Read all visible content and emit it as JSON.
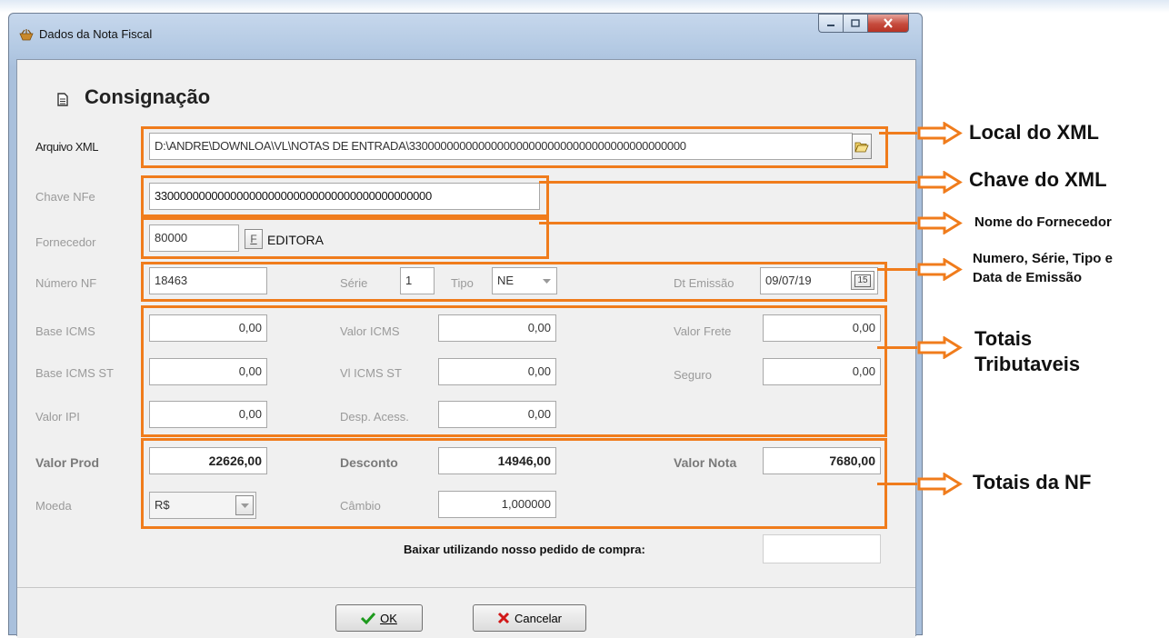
{
  "window": {
    "title": "Dados da Nota Fiscal"
  },
  "form": {
    "heading": "Consignação",
    "xml": {
      "label": "Arquivo XML",
      "value": "D:\\ANDRE\\DOWNLOA\\VL\\NOTAS DE ENTRADA\\33000000000000000000000000000000000000000000"
    },
    "chave": {
      "label": "Chave NFe",
      "value": "33000000000000000000000000000000000000000000"
    },
    "fornecedor": {
      "label": "Fornecedor",
      "code": "80000",
      "button": "F",
      "name": "EDITORA"
    },
    "numero": {
      "label": "Número NF",
      "value": "18463"
    },
    "serie": {
      "label": "Série",
      "value": "1"
    },
    "tipo": {
      "label": "Tipo",
      "value": "NE"
    },
    "emissao": {
      "label": "Dt Emissão",
      "value": "09/07/19",
      "icon": "15"
    },
    "base_icms": {
      "label": "Base ICMS",
      "value": "0,00"
    },
    "valor_icms": {
      "label": "Valor ICMS",
      "value": "0,00"
    },
    "valor_frete": {
      "label": "Valor Frete",
      "value": "0,00"
    },
    "base_icms_st": {
      "label": "Base ICMS ST",
      "value": "0,00"
    },
    "vl_icms_st": {
      "label": "Vl ICMS ST",
      "value": "0,00"
    },
    "seguro": {
      "label": "Seguro",
      "value": "0,00"
    },
    "valor_ipi": {
      "label": "Valor IPI",
      "value": "0,00"
    },
    "desp_acess": {
      "label": "Desp. Acess.",
      "value": "0,00"
    },
    "valor_prod": {
      "label": "Valor Prod",
      "value": "22626,00"
    },
    "desconto": {
      "label": "Desconto",
      "value": "14946,00"
    },
    "valor_nota": {
      "label": "Valor Nota",
      "value": "7680,00"
    },
    "moeda": {
      "label": "Moeda",
      "value": "R$"
    },
    "cambio": {
      "label": "Câmbio",
      "value": "1,000000"
    },
    "pedido": {
      "label": "Baixar utilizando nosso pedido de compra:",
      "value": ""
    }
  },
  "buttons": {
    "ok": "OK",
    "cancel": "Cancelar"
  },
  "annotations": {
    "local_xml": "Local do XML",
    "chave_xml": "Chave do XML",
    "nome_fornecedor": "Nome do Fornecedor",
    "numero_line1": "Numero, Série, Tipo e",
    "numero_line2": "Data de Emissão",
    "totais_trib_line1": "Totais",
    "totais_trib_line2": "Tributaveis",
    "totais_nf": "Totais da NF"
  },
  "colors": {
    "highlight": "#f07c1c",
    "window_frame": "#b3c9e3",
    "client": "#f0f0f0"
  },
  "icons": [
    "app-icon",
    "document-icon",
    "folder-open-icon",
    "calendar-icon",
    "dropdown-arrow-icon",
    "check-icon",
    "x-icon",
    "minimize-icon",
    "maximize-icon",
    "close-icon"
  ]
}
